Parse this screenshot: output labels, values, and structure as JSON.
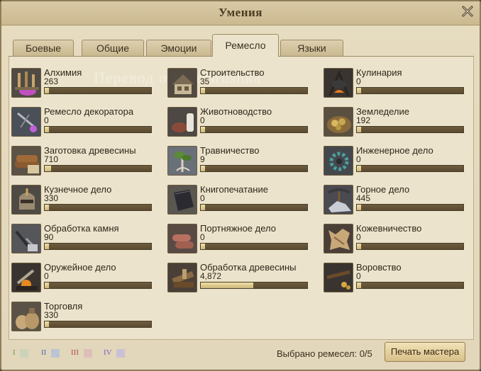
{
  "window": {
    "title": "Умения"
  },
  "tabs": [
    {
      "label": "Боевые"
    },
    {
      "label": "Общие"
    },
    {
      "label": "Эмоции"
    },
    {
      "label": "Ремесло"
    },
    {
      "label": "Языки"
    }
  ],
  "active_tab": "Ремесло",
  "watermark": "Перевод от Terrarushka",
  "skills": [
    {
      "name": "Алхимия",
      "value": "263",
      "progress": 0.02,
      "icon": "alchemy-icon"
    },
    {
      "name": "Ремесло декоратора",
      "value": "0",
      "progress": 0.0,
      "icon": "handicraft-icon"
    },
    {
      "name": "Заготовка древесины",
      "value": "710",
      "progress": 0.06,
      "icon": "logging-icon"
    },
    {
      "name": "Кузнечное дело",
      "value": "330",
      "progress": 0.03,
      "icon": "metalwork-icon"
    },
    {
      "name": "Обработка камня",
      "value": "90",
      "progress": 0.01,
      "icon": "stonework-icon"
    },
    {
      "name": "Оружейное дело",
      "value": "0",
      "progress": 0.0,
      "icon": "weaponry-icon"
    },
    {
      "name": "Торговля",
      "value": "330",
      "progress": 0.03,
      "icon": "commerce-icon"
    },
    {
      "name": "Строительство",
      "value": "35",
      "progress": 0.005,
      "icon": "construction-icon"
    },
    {
      "name": "Животноводство",
      "value": "0",
      "progress": 0.0,
      "icon": "husbandry-icon"
    },
    {
      "name": "Травничество",
      "value": "9",
      "progress": 0.002,
      "icon": "herbalism-icon"
    },
    {
      "name": "Книгопечатание",
      "value": "0",
      "progress": 0.0,
      "icon": "printing-icon"
    },
    {
      "name": "Портняжное дело",
      "value": "0",
      "progress": 0.0,
      "icon": "tailoring-icon"
    },
    {
      "name": "Обработка древесины",
      "value": "4,872",
      "progress": 0.49,
      "icon": "carpentry-icon"
    },
    {
      "name": "Кулинария",
      "value": "0",
      "progress": 0.0,
      "icon": "cooking-icon"
    },
    {
      "name": "Земледелие",
      "value": "192",
      "progress": 0.015,
      "icon": "farming-icon"
    },
    {
      "name": "Инженерное дело",
      "value": "0",
      "progress": 0.0,
      "icon": "machining-icon"
    },
    {
      "name": "Горное дело",
      "value": "445",
      "progress": 0.04,
      "icon": "mining-icon"
    },
    {
      "name": "Кожевничество",
      "value": "0",
      "progress": 0.0,
      "icon": "leatherwork-icon"
    },
    {
      "name": "Воровство",
      "value": "0",
      "progress": 0.0,
      "icon": "larceny-icon"
    }
  ],
  "legend": [
    {
      "label": "I",
      "color": "#6d9a4a",
      "swatch": "#c9d4b8"
    },
    {
      "label": "II",
      "color": "#4a6fb0",
      "swatch": "#bcc4d4"
    },
    {
      "label": "III",
      "color": "#b04a4a",
      "swatch": "#dcc0b8"
    },
    {
      "label": "IV",
      "color": "#8a5ab8",
      "swatch": "#cac0d6"
    }
  ],
  "footer": {
    "selected_label": "Выбрано ремесел:",
    "selected_value": "0/5",
    "print_button": "Печать мастера"
  },
  "colors": {
    "panel_bg": "#ebe3cc",
    "bar_fill": "#e4d499",
    "bar_bg": "#5b4b30"
  }
}
